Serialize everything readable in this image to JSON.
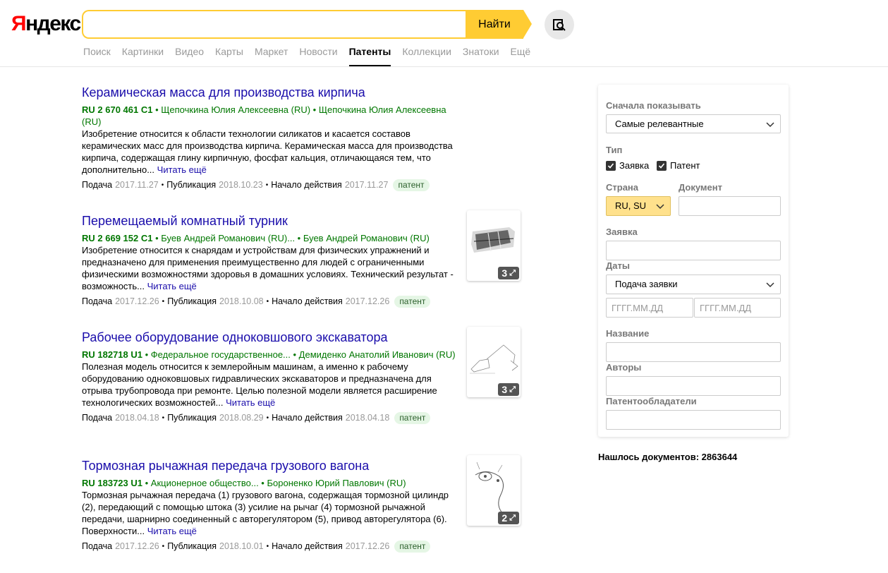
{
  "header": {
    "logo_first": "Я",
    "logo_rest": "ндекс",
    "search_value": "",
    "search_button": "Найти",
    "nav": [
      "Поиск",
      "Картинки",
      "Видео",
      "Карты",
      "Маркет",
      "Новости",
      "Патенты",
      "Коллекции",
      "Знатоки",
      "Ещё"
    ],
    "nav_active": "Патенты"
  },
  "results": [
    {
      "title": "Керамическая масса для производства кирпича",
      "number": "RU 2 670 461 C1",
      "authors": " • Щепочкина Юлия Алексеевна (RU) • Щепочкина Юлия Алексеевна (RU)",
      "snippet": "Изобретение относится к области технологии силикатов и касается составов керамических масс для производства кирпича. Керамическая масса для производства кирпича, содержащая глину кирпичную, фосфат кальция, отличающаяся тем, что дополнительно... ",
      "read_more": "Читать ещё",
      "filed_label": "Подача",
      "filed": "2017.11.27",
      "published_label": "Публикация",
      "published": "2018.10.23",
      "start_label": "Начало действия",
      "start": "2017.11.27",
      "badge": "патент",
      "thumb_count": ""
    },
    {
      "title": "Перемещаемый комнатный турник",
      "number": "RU 2 669 152 C1",
      "authors": " • Буев Андрей Романович (RU)... • Буев Андрей Романович (RU)",
      "snippet": "Изобретение относится к снарядам и устройствам для физических упражнений и предназначено для применения преимущественно для людей с ограниченными физическими возможностями здоровья в домашних условиях. Технический результат - возможность... ",
      "read_more": "Читать ещё",
      "filed_label": "Подача",
      "filed": "2017.12.26",
      "published_label": "Публикация",
      "published": "2018.10.08",
      "start_label": "Начало действия",
      "start": "2017.12.26",
      "badge": "патент",
      "thumb_count": "3"
    },
    {
      "title": "Рабочее оборудование одноковшового экскаватора",
      "number": "RU 182718 U1",
      "authors": " • Федеральное государственное... • Демиденко Анатолий Иванович (RU)",
      "snippet": "Полезная модель относится к землеройным машинам, а именно к рабочему оборудованию одноковшовых гидравлических экскаваторов и предназначена для отрыва трубопровода при ремонте. Целью полезной модели является расширение технологических возможностей... ",
      "read_more": "Читать ещё",
      "filed_label": "Подача",
      "filed": "2018.04.18",
      "published_label": "Публикация",
      "published": "2018.08.29",
      "start_label": "Начало действия",
      "start": "2018.04.18",
      "badge": "патент",
      "thumb_count": "3"
    },
    {
      "title": "Тормозная рычажная передача грузового вагона",
      "number": "RU 183723 U1",
      "authors": " • Акционерное общество... • Бороненко Юрий Павлович (RU)",
      "snippet": "Тормозная рычажная передача (1) грузового вагона, содержащая тормозной цилиндр (2), передающий с помощью штока (3) усилие на рычаг (4) тормозной рычажной передачи, шарнирно соединенный с авторегулятором (5), привод авторегулятора (6). Поверхности... ",
      "read_more": "Читать ещё",
      "filed_label": "Подача",
      "filed": "2017.12.26",
      "published_label": "Публикация",
      "published": "2018.10.01",
      "start_label": "Начало действия",
      "start": "2017.12.26",
      "badge": "патент",
      "thumb_count": "2"
    }
  ],
  "filters": {
    "sort_label": "Сначала показывать",
    "sort_value": "Самые релевантные",
    "type_label": "Тип",
    "type_app": "Заявка",
    "type_patent": "Патент",
    "country_label": "Страна",
    "country_value": "RU, SU",
    "document_label": "Документ",
    "document_value": "",
    "application_label": "Заявка",
    "application_value": "",
    "dates_label": "Даты",
    "dates_value": "Подача заявки",
    "date_from_placeholder": "ГГГГ.ММ.ДД",
    "date_to_placeholder": "ГГГГ.ММ.ДД",
    "name_label": "Название",
    "name_value": "",
    "authors_label": "Авторы",
    "authors_value": "",
    "holders_label": "Патентообладатели",
    "holders_value": ""
  },
  "found": "Нашлось документов: 2863644",
  "colors": {
    "accent": "#ffcc33",
    "link": "#1a0dab",
    "green": "#007700"
  }
}
